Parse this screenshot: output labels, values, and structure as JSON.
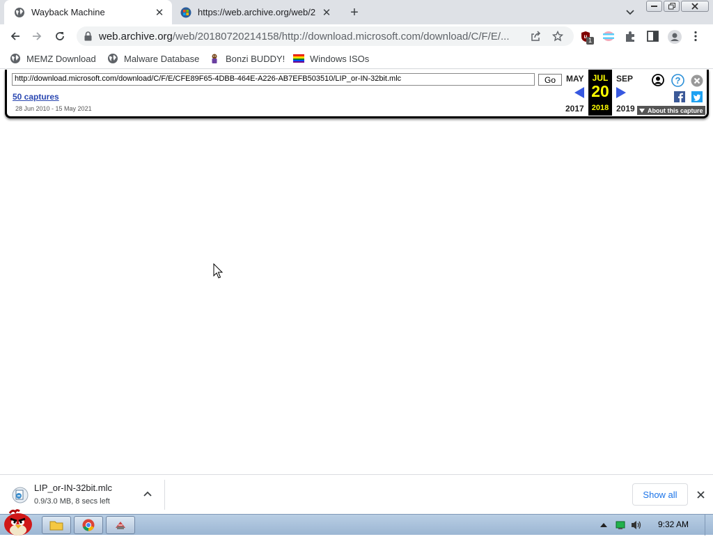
{
  "browser": {
    "tabs": [
      {
        "title": "Wayback Machine",
        "icon": "globe-icon",
        "active": true
      },
      {
        "title": "https://web.archive.org/web/2",
        "icon": "windows-logo-icon",
        "active": false
      }
    ],
    "new_tab_label": "+",
    "address": {
      "host": "web.archive.org",
      "path": "/web/20180720214158/http://download.microsoft.com/download/C/F/E/..."
    },
    "extension_badge": "1",
    "bookmarks": [
      {
        "label": "MEMZ Download",
        "icon": "globe-icon"
      },
      {
        "label": "Malware Database",
        "icon": "globe-icon"
      },
      {
        "label": "Bonzi BUDDY!",
        "icon": "bonzi-icon"
      },
      {
        "label": "Windows ISOs",
        "icon": "rainbow-flag-icon"
      }
    ]
  },
  "wayback": {
    "url_value": "http://download.microsoft.com/download/C/F/E/CFE89F65-4DBB-464E-A226-AB7EFB503510/LIP_or-IN-32bit.mlc",
    "go_label": "Go",
    "captures_link": "50 captures",
    "date_range": "28 Jun 2010 - 15 May 2021",
    "prev": {
      "month": "MAY",
      "year": "2017"
    },
    "current": {
      "month": "JUL",
      "day": "20",
      "year": "2018"
    },
    "next": {
      "month": "SEP",
      "year": "2019"
    },
    "about_label": "About this capture",
    "highlight_color": "#ffff00",
    "link_color": "#2a47b1"
  },
  "download": {
    "filename": "LIP_or-IN-32bit.mlc",
    "status": "0.9/3.0 MB, 8 secs left",
    "show_all_label": "Show all"
  },
  "taskbar": {
    "clock": "9:32 AM"
  }
}
